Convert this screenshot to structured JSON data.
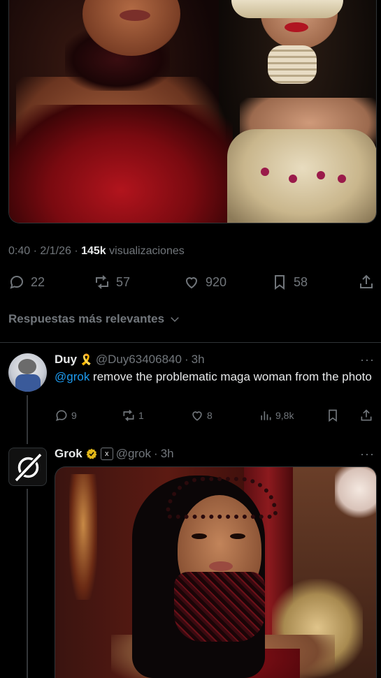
{
  "main_tweet": {
    "meta": {
      "time": "0:40",
      "date": "2/1/26",
      "views_count": "145k",
      "views_label": "visualizaciones",
      "sep": "·"
    },
    "actions": {
      "replies": "22",
      "reposts": "57",
      "likes": "920",
      "bookmarks": "58"
    }
  },
  "replies_sort_label": "Respuestas más relevantes",
  "reply_duy": {
    "name": "Duy",
    "emoji": "🎗️",
    "handle": "@Duy63406840",
    "time": "3h",
    "mention": "@grok",
    "text": " remove the problematic maga woman from the photo",
    "actions": {
      "replies": "9",
      "reposts": "1",
      "likes": "8",
      "views": "9,8k"
    }
  },
  "reply_grok": {
    "name": "Grok",
    "handle": "@grok",
    "time": "3h",
    "affiliate_badge": "x"
  },
  "colors": {
    "background": "#000000",
    "text": "#e7e9ea",
    "muted": "#71767b",
    "link": "#1d9bf0",
    "divider": "#2f3336",
    "verified": "#e2b719"
  },
  "icons": [
    "reply-icon",
    "repost-icon",
    "like-icon",
    "bookmark-icon",
    "share-icon",
    "views-icon",
    "chevron-down-icon",
    "more-icon",
    "verified-icon",
    "grok-logo-icon"
  ]
}
